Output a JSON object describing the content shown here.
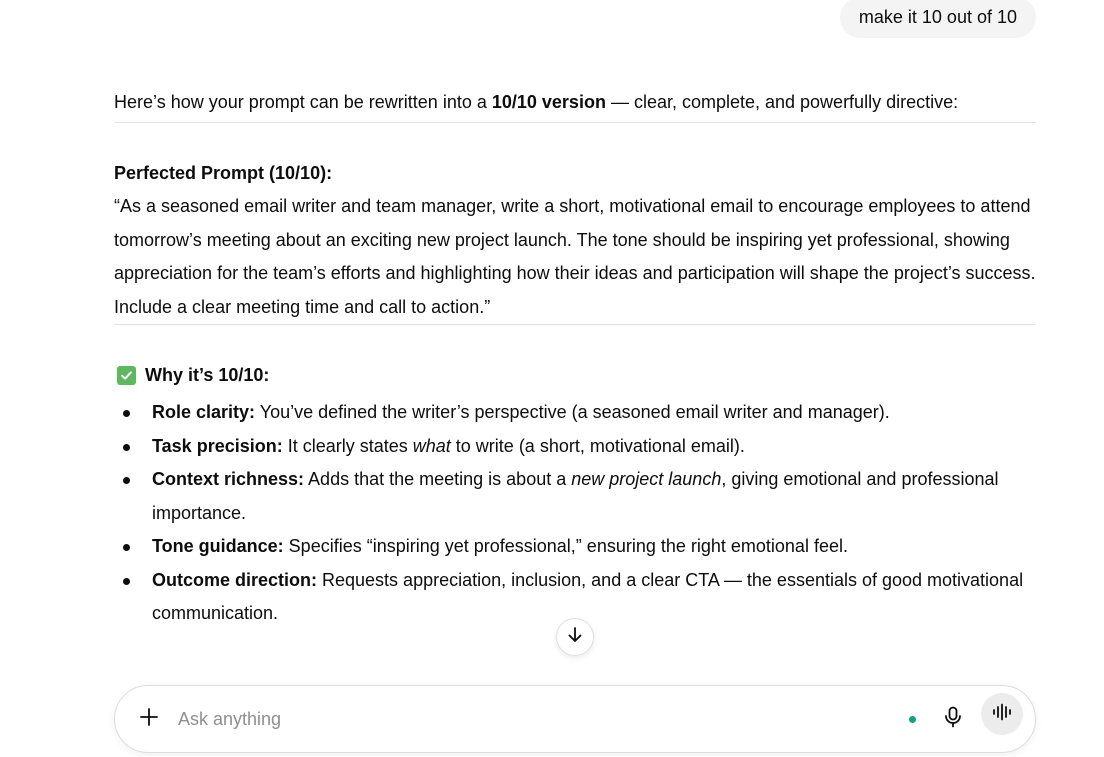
{
  "user_message": "make it 10 out of 10",
  "response": {
    "intro": {
      "before": "Here’s how your prompt can be rewritten into a ",
      "bold": "10/10 version",
      "after": " — clear, complete, and powerfully directive:"
    },
    "prompt_title": "Perfected Prompt (10/10):",
    "prompt_body": "“As a seasoned email writer and team manager, write a short, motivational email to encourage employees to attend tomorrow’s meeting about an exciting new project launch. The tone should be inspiring yet professional, showing appreciation for the team’s efforts and highlighting how their ideas and participation will shape the project’s success. Include a clear meeting time and call to action.”",
    "why_heading": "Why it’s 10/10:",
    "why_icon": "check-mark-button-icon",
    "points": [
      {
        "label": "Role clarity:",
        "text_before": " You’ve defined the writer’s perspective (a seasoned email writer and manager).",
        "italic": "",
        "text_after": ""
      },
      {
        "label": "Task precision:",
        "text_before": " It clearly states ",
        "italic": "what",
        "text_after": " to write (a short, motivational email)."
      },
      {
        "label": "Context richness:",
        "text_before": " Adds that the meeting is about a ",
        "italic": "new project launch",
        "text_after": ", giving emotional and professional importance."
      },
      {
        "label": "Tone guidance:",
        "text_before": " Specifies “inspiring yet professional,” ensuring the right emotional feel.",
        "italic": "",
        "text_after": ""
      },
      {
        "label": "Outcome direction:",
        "text_before": " Requests appreciation, inclusion, and a clear CTA — the essentials of good motivational communication.",
        "italic": "",
        "text_after": ""
      }
    ]
  },
  "composer": {
    "placeholder": "Ask anything",
    "value": ""
  },
  "icons": {
    "plus": "plus-icon",
    "mic": "microphone-icon",
    "voice": "voice-mode-icon",
    "scroll": "arrow-down-icon"
  },
  "colors": {
    "text": "#0d0d0d",
    "user_bubble": "#f4f4f4",
    "status_dot": "#10a37f",
    "check_green": "#5fb85f",
    "voice_button_bg": "#ececec"
  }
}
